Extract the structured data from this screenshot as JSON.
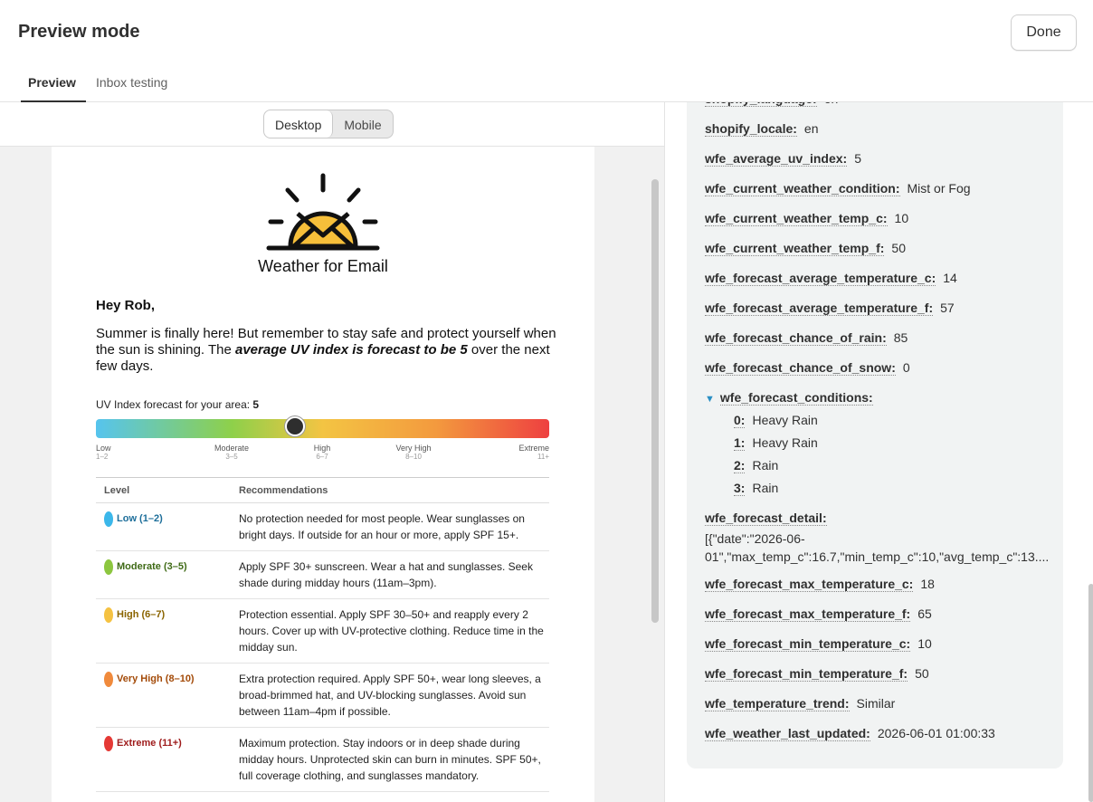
{
  "header": {
    "title": "Preview mode",
    "done_label": "Done",
    "tabs": [
      "Preview",
      "Inbox testing"
    ]
  },
  "toggle": {
    "desktop": "Desktop",
    "mobile": "Mobile"
  },
  "email": {
    "brand": "Weather for Email",
    "greeting": "Hey Rob,",
    "para_start": "Summer is finally here! But remember to stay safe and protect yourself when the sun is shining. The ",
    "para_bold": "average UV index is forecast to be 5",
    "para_end": " over the next few days.",
    "uv_label": "UV Index forecast for your area: ",
    "uv_value": "5",
    "scale": [
      {
        "label": "Low",
        "range": "1–2"
      },
      {
        "label": "Moderate",
        "range": "3–5"
      },
      {
        "label": "High",
        "range": "6–7"
      },
      {
        "label": "Very High",
        "range": "8–10"
      },
      {
        "label": "Extreme",
        "range": "11+"
      }
    ],
    "table_headers": [
      "Level",
      "Recommendations"
    ],
    "rows": [
      {
        "level": "Low (1–2)",
        "color": "#3bb7ea",
        "text_color": "#1d6e9a",
        "rec": "No protection needed for most people. Wear sunglasses on bright days. If outside for an hour or more, apply SPF 15+."
      },
      {
        "level": "Moderate (3–5)",
        "color": "#8cc63f",
        "text_color": "#3f6a16",
        "rec": "Apply SPF 30+ sunscreen. Wear a hat and sunglasses. Seek shade during midday hours (11am–3pm)."
      },
      {
        "level": "High (6–7)",
        "color": "#f5c242",
        "text_color": "#8a6400",
        "rec": "Protection essential. Apply SPF 30–50+ and reapply every 2 hours. Cover up with UV-protective clothing. Reduce time in the midday sun."
      },
      {
        "level": "Very High (8–10)",
        "color": "#f08a3c",
        "text_color": "#a34a08",
        "rec": "Extra protection required. Apply SPF 50+, wear long sleeves, a broad-brimmed hat, and UV-blocking sunglasses. Avoid sun between 11am–4pm if possible."
      },
      {
        "level": "Extreme (11+)",
        "color": "#e53935",
        "text_color": "#9e1b1b",
        "rec": "Maximum protection. Stay indoors or in deep shade during midday hours. Unprotected skin can burn in minutes. SPF 50+, full coverage clothing, and sunglasses mandatory."
      }
    ]
  },
  "variables": [
    {
      "key": "shopify_language:",
      "value": "en"
    },
    {
      "key": "shopify_locale:",
      "value": "en"
    },
    {
      "key": "wfe_average_uv_index:",
      "value": "5"
    },
    {
      "key": "wfe_current_weather_condition:",
      "value": "Mist or Fog"
    },
    {
      "key": "wfe_current_weather_temp_c:",
      "value": "10"
    },
    {
      "key": "wfe_current_weather_temp_f:",
      "value": "50"
    },
    {
      "key": "wfe_forecast_average_temperature_c:",
      "value": "14"
    },
    {
      "key": "wfe_forecast_average_temperature_f:",
      "value": "57"
    },
    {
      "key": "wfe_forecast_chance_of_rain:",
      "value": "85"
    },
    {
      "key": "wfe_forecast_chance_of_snow:",
      "value": "0"
    }
  ],
  "conditions": {
    "key": "wfe_forecast_conditions:",
    "items": [
      {
        "idx": "0:",
        "value": "Heavy Rain"
      },
      {
        "idx": "1:",
        "value": "Heavy Rain"
      },
      {
        "idx": "2:",
        "value": "Rain"
      },
      {
        "idx": "3:",
        "value": "Rain"
      }
    ]
  },
  "detail": {
    "key": "wfe_forecast_detail:",
    "line1": "[{\"date\":\"2026-06-",
    "line2": "01\",\"max_temp_c\":16.7,\"min_temp_c\":10,\"avg_temp_c\":13...."
  },
  "variables2": [
    {
      "key": "wfe_forecast_max_temperature_c:",
      "value": "18"
    },
    {
      "key": "wfe_forecast_max_temperature_f:",
      "value": "65"
    },
    {
      "key": "wfe_forecast_min_temperature_c:",
      "value": "10"
    },
    {
      "key": "wfe_forecast_min_temperature_f:",
      "value": "50"
    },
    {
      "key": "wfe_temperature_trend:",
      "value": "Similar"
    },
    {
      "key": "wfe_weather_last_updated:",
      "value": "2026-06-01 01:00:33"
    }
  ],
  "uv_level_fraction": 0.44
}
